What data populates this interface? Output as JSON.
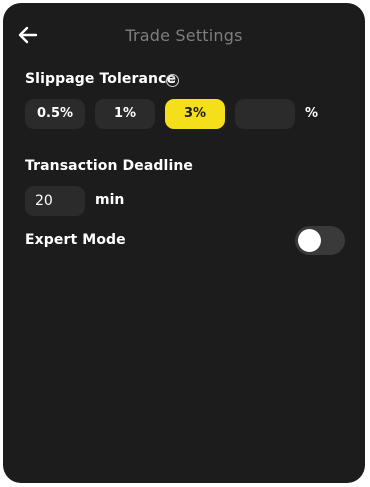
{
  "header": {
    "title": "Trade Settings",
    "back_icon": "arrow-left-icon"
  },
  "slippage": {
    "label": "Slippage Tolerance",
    "help_icon": "question-circle-icon",
    "help_glyph": "?",
    "options": [
      "0.5%",
      "1%",
      "3%"
    ],
    "selected": "3%",
    "custom_value": "",
    "unit": "%"
  },
  "deadline": {
    "label": "Transaction Deadline",
    "value": "20",
    "unit": "min"
  },
  "expert_mode": {
    "label": "Expert Mode",
    "enabled": false
  },
  "colors": {
    "panel_bg": "#1c1c1c",
    "control_bg": "#2b2b2b",
    "accent": "#f4df1a",
    "title_text": "#7e7e7e",
    "text": "#ffffff"
  }
}
